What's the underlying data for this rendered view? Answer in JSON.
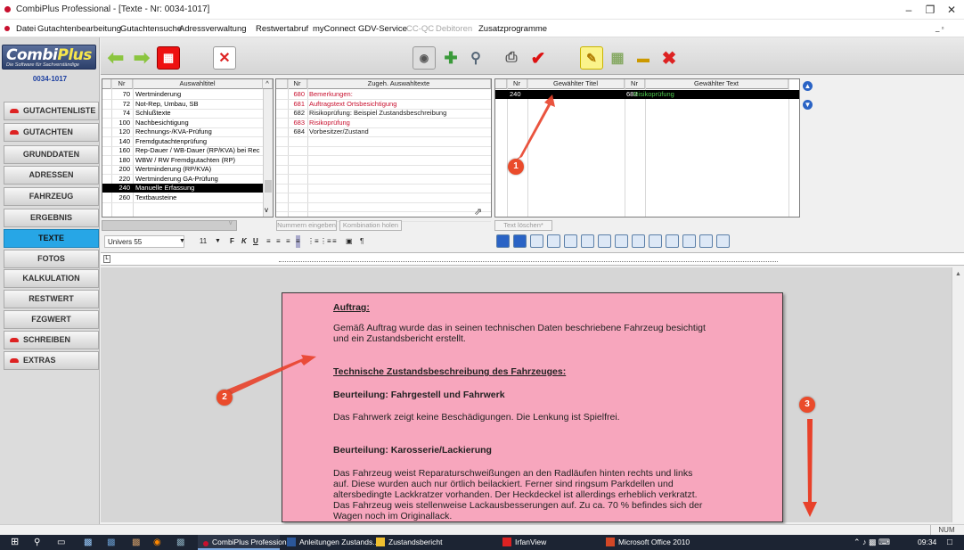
{
  "window": {
    "title": "CombiPlus Professional - [Texte - Nr: 0034-1017]"
  },
  "menu": [
    "Datei",
    "Gutachtenbearbeitung",
    "Gutachtensuche",
    "Adressverwaltung",
    "Restwertabruf",
    "myConnect",
    "GDV-Service",
    "CC-QC",
    "Debitoren",
    "Zusatzprogramme"
  ],
  "logo": {
    "text": "Combi",
    "text2": "Plus",
    "slogan": "Die Software für Sachverständige"
  },
  "record_no": "0034-1017",
  "nav": [
    {
      "label": "GUTACHTENLISTE",
      "icon": true
    },
    {
      "label": "GUTACHTEN",
      "icon": true
    },
    {
      "label": "GRUNDDATEN",
      "icon": false
    },
    {
      "label": "ADRESSEN",
      "icon": false
    },
    {
      "label": "FAHRZEUG",
      "icon": false
    },
    {
      "label": "ERGEBNIS",
      "icon": false
    },
    {
      "label": "TEXTE",
      "icon": false,
      "active": true
    },
    {
      "label": "FOTOS",
      "icon": false
    },
    {
      "label": "KALKULATION",
      "icon": false
    },
    {
      "label": "RESTWERT",
      "icon": false
    },
    {
      "label": "FZGWERT",
      "icon": false
    },
    {
      "label": "SCHREIBEN",
      "icon": true
    },
    {
      "label": "EXTRAS",
      "icon": true
    }
  ],
  "grid1": {
    "headers": [
      "Nr",
      "Auswahltitel"
    ],
    "rows": [
      [
        "70",
        "Wertminderung"
      ],
      [
        "72",
        "Not-Rep, Umbau, SB"
      ],
      [
        "74",
        "Schlußtexte"
      ],
      [
        "100",
        "Nachbesichtigung"
      ],
      [
        "120",
        "Rechnungs-/KVA-Prüfung"
      ],
      [
        "140",
        "Fremdgutachtenprüfung"
      ],
      [
        "160",
        "Rep-Dauer / WB-Dauer (RP/KVA) bei Rec"
      ],
      [
        "180",
        "WBW / RW Fremdgutachten (RP)"
      ],
      [
        "200",
        "Wertminderung (RP/KVA)"
      ],
      [
        "220",
        "Wertminderung GA-Prüfung"
      ],
      [
        "240",
        "Manuelle Erfassung"
      ],
      [
        "260",
        "Textbausteine"
      ]
    ],
    "selected": 10
  },
  "grid2": {
    "headers": [
      "Nr",
      "Zugeh. Auswahltexte"
    ],
    "rows": [
      [
        "680",
        "Bemerkungen:",
        "red"
      ],
      [
        "681",
        "Auftragstext Ortsbesichtigung",
        "red"
      ],
      [
        "682",
        "Risikoprüfung: Beispiel Zustandsbeschreibung",
        "black"
      ],
      [
        "683",
        "Risikoprüfung",
        "red"
      ],
      [
        "684",
        "Vorbesitzer/Zustand",
        "black"
      ]
    ]
  },
  "grid3": {
    "headers": [
      "Nr",
      "Gewählter Titel",
      "Nr",
      "Gewählter Text"
    ],
    "rows": [
      [
        "240",
        "",
        "683",
        "Risikoprüfung"
      ]
    ]
  },
  "buttons": {
    "nummern": "Nummern eingeben",
    "kombination": "Kombination holen",
    "textloeschen": "Text löschen*"
  },
  "format": {
    "font": "Univers 55",
    "size": "11",
    "bold": "F",
    "italic": "K",
    "underline": "U"
  },
  "document": [
    {
      "text": "Auftrag:",
      "style": "u"
    },
    {
      "text": "Gemäß Auftrag wurde das in seinen technischen Daten beschriebene Fahrzeug besichtigt\nund ein Zustandsbericht erstellt.",
      "style": ""
    },
    {
      "text": "Technische Zustandsbeschreibung des Fahrzeuges:",
      "style": "u"
    },
    {
      "text": "Beurteilung: Fahrgestell und Fahrwerk",
      "style": "b"
    },
    {
      "text": "Das Fahrwerk zeigt keine Beschädigungen. Die Lenkung ist Spielfrei.",
      "style": ""
    },
    {
      "text": "Beurteilung: Karosserie/Lackierung",
      "style": "b"
    },
    {
      "text": "Das Fahrzeug weist Reparaturschweißungen an den Radläufen hinten rechts und links\nauf. Diese wurden auch nur örtlich beilackiert. Ferner sind ringsum Parkdellen und\naltersbedingte Lackkratzer vorhanden. Der Heckdeckel ist allerdings erheblich verkratzt.\nDas Fahrzeug weis stellenweise Lackausbesserungen auf. Zu ca. 70 % befindes sich der\nWagen noch im Originallack.",
      "style": ""
    }
  ],
  "badges": [
    "1",
    "2",
    "3"
  ],
  "status": {
    "num": "NUM"
  },
  "taskbar": {
    "items": [
      "CombiPlus Profession...",
      "Anleitungen Zustands...",
      "Zustandsbericht",
      "IrfanView",
      "Microsoft Office 2010"
    ],
    "time": "09:34"
  },
  "colors": {
    "accent": "#27a6e6",
    "page": "#f7a6bd",
    "red_text": "#c8102e",
    "badge": "#ea4b2b"
  }
}
